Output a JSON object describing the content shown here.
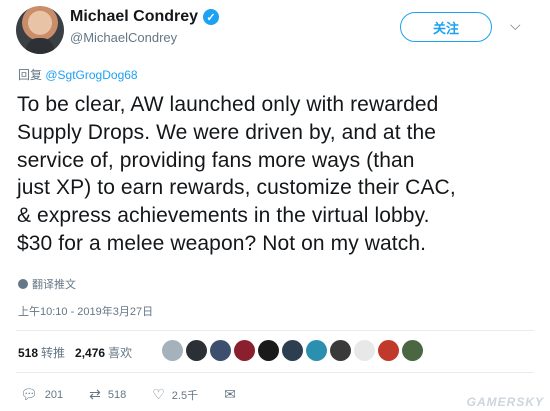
{
  "author": {
    "name": "Michael Condrey",
    "handle": "@MichaelCondrey"
  },
  "header": {
    "follow_label": "关注"
  },
  "reply": {
    "prefix": "回复",
    "mention": "@SgtGrogDog68"
  },
  "tweet": {
    "lines": [
      "To be clear, AW launched only with rewarded",
      "Supply Drops. We were driven by, and at the",
      "service of, providing fans more ways (than",
      "just XP) to earn rewards, customize their CAC,",
      "& express achievements in the virtual lobby.",
      "$30 for a melee weapon? Not on my watch."
    ],
    "translate_label": "翻译推文",
    "timestamp": "上午10:10 - 2019年3月27日"
  },
  "stats": {
    "retweets_count": "518",
    "retweets_label": "转推",
    "likes_count": "2,476",
    "likes_label": "喜欢"
  },
  "likers_colors": [
    "#a5b1bb",
    "#2b2f36",
    "#3d4f6e",
    "#8a1f2e",
    "#1a1a1a",
    "#2c3e50",
    "#2b8fb0",
    "#3a3a3a",
    "#e8e8e8",
    "#c0392b",
    "#4a6741"
  ],
  "actions": {
    "reply_count": "201",
    "retweet_count": "518",
    "like_count": "2.5千"
  },
  "watermark": "GAMERSKY"
}
